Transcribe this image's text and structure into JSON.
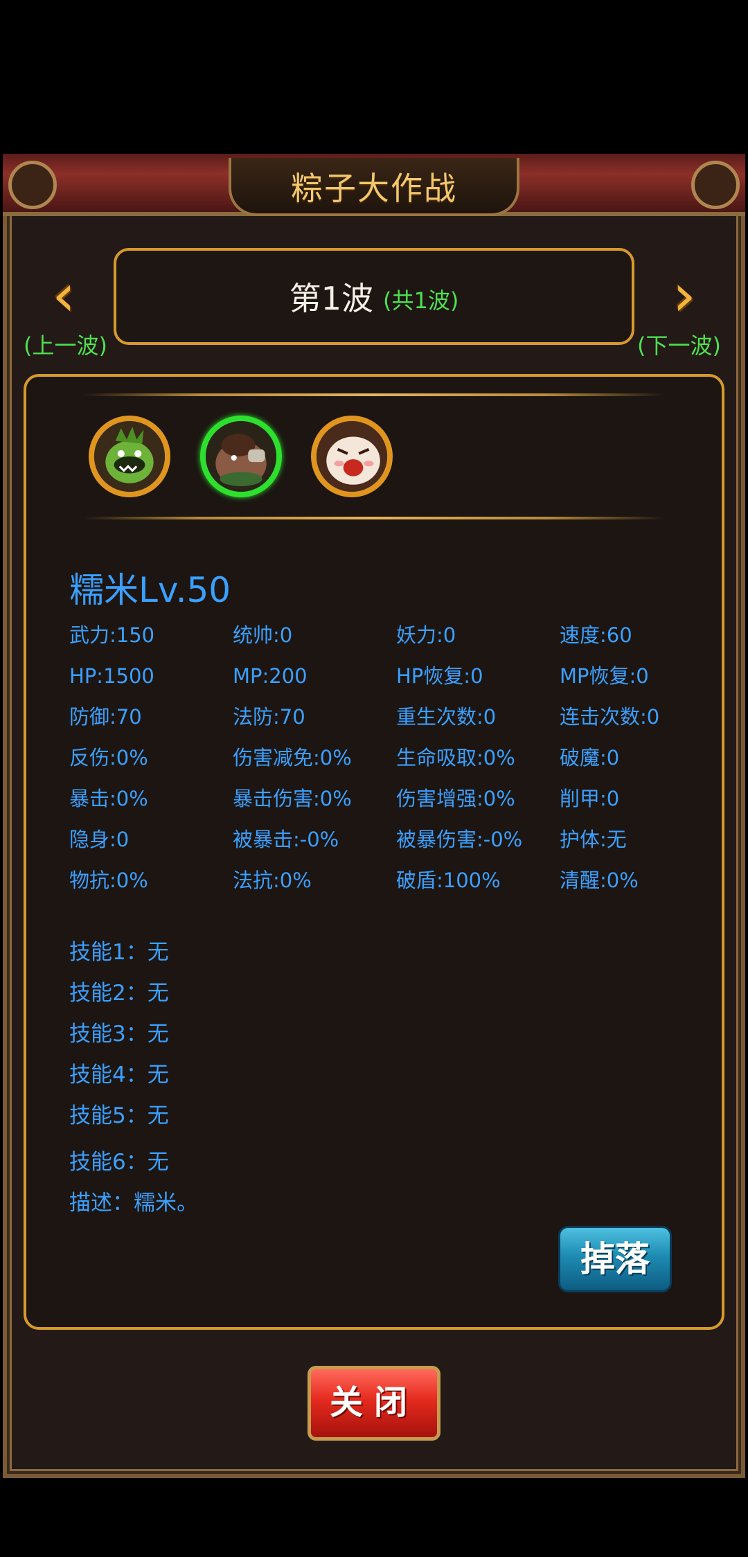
{
  "header": {
    "title": "粽子大作战"
  },
  "wave": {
    "current": "第1波",
    "total": "(共1波)",
    "prev_label": "(上一波)",
    "next_label": "(下一波)"
  },
  "monsters": [
    {
      "name": "green-monster",
      "selected": false
    },
    {
      "name": "brute-monster",
      "selected": true
    },
    {
      "name": "rice-ball-monster",
      "selected": false
    }
  ],
  "detail": {
    "name": "糯米Lv.50",
    "stats": [
      "武力:150",
      "统帅:0",
      "妖力:0",
      "速度:60",
      "HP:1500",
      "MP:200",
      "HP恢复:0",
      "MP恢复:0",
      "防御:70",
      "法防:70",
      "重生次数:0",
      "连击次数:0",
      "反伤:0%",
      "伤害减免:0%",
      "生命吸取:0%",
      "破魔:0",
      "暴击:0%",
      "暴击伤害:0%",
      "伤害增强:0%",
      "削甲:0",
      "隐身:0",
      "被暴击:-0%",
      "被暴伤害:-0%",
      "护体:无",
      "物抗:0%",
      "法抗:0%",
      "破盾:100%",
      "清醒:0%"
    ],
    "skills": [
      "技能1：无",
      "技能2：无",
      "技能3：无",
      "技能4：无",
      "技能5：无",
      "技能6：无",
      "描述：糯米。"
    ]
  },
  "buttons": {
    "drop": "掉落",
    "close": "关闭"
  },
  "colors": {
    "text_blue": "#3aa0ff",
    "text_green": "#4fe04f",
    "gold": "#d69a2a"
  }
}
